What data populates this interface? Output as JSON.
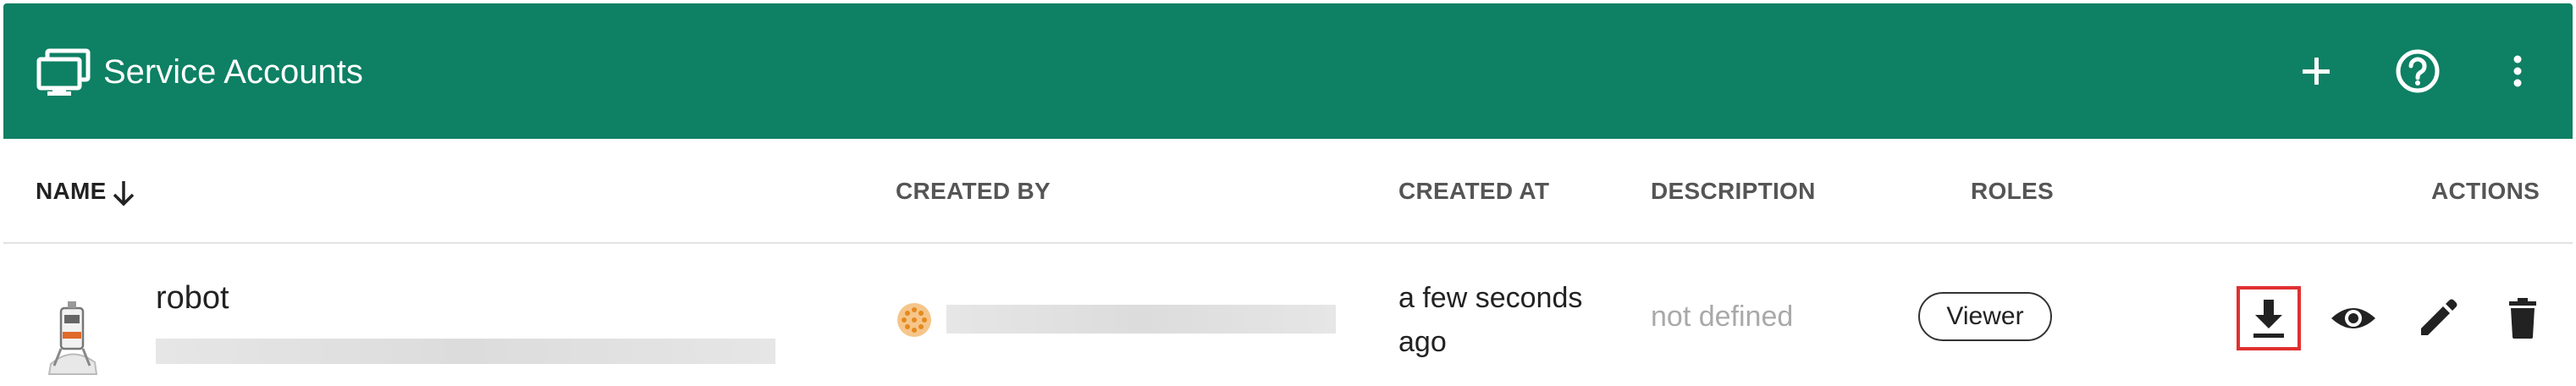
{
  "colors": {
    "toolbar_bg": "#0e8064",
    "toolbar_text": "#ffffff",
    "highlight": "#e03030",
    "muted_text": "#a9a9a9"
  },
  "toolbar": {
    "title_icon": "monitor-icon",
    "title": "Service Accounts",
    "actions": [
      {
        "icon": "add-icon"
      },
      {
        "icon": "help-icon"
      },
      {
        "icon": "more-vert-icon"
      }
    ]
  },
  "table": {
    "columns": [
      "NAME",
      "CREATED BY",
      "CREATED AT",
      "DESCRIPTION",
      "ROLES",
      "ACTIONS"
    ],
    "sort_icon": "arrow-down-icon",
    "rows": [
      {
        "avatar_icon": "robot-avatar-icon",
        "name": "robot",
        "creator_avatar_icon": "user-identicon-icon",
        "created_at": "a few seconds ago",
        "description": "not defined",
        "role": "Viewer",
        "actions": [
          "download-icon",
          "view-icon",
          "edit-icon",
          "delete-icon"
        ]
      }
    ]
  }
}
